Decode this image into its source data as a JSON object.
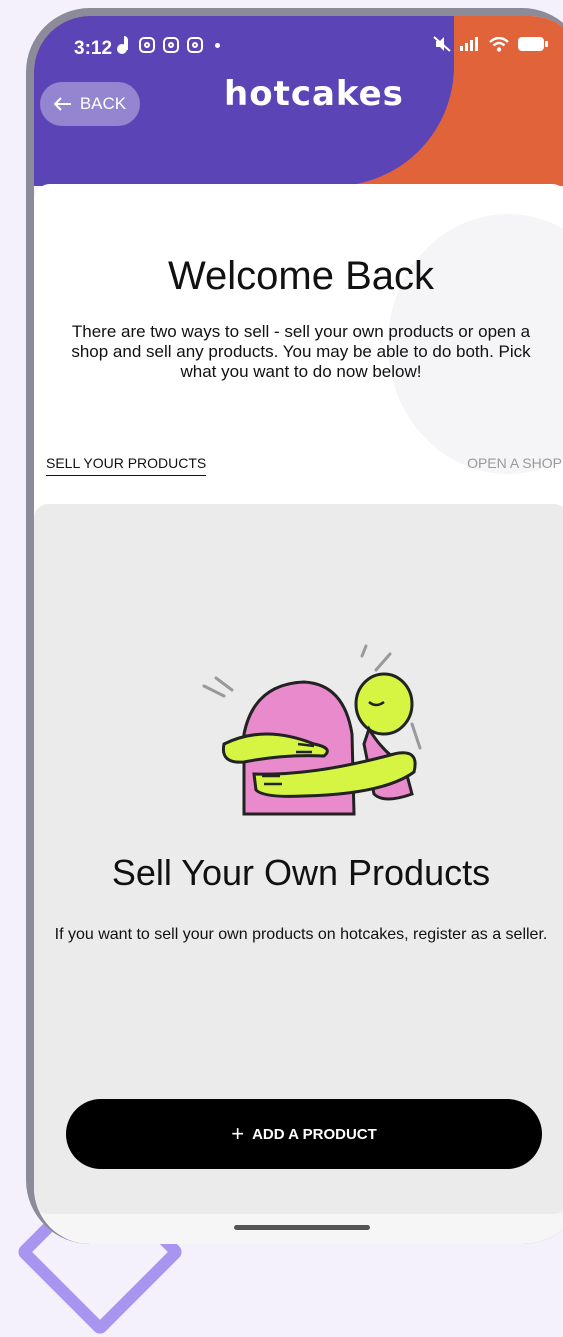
{
  "status_bar": {
    "time": "3:12"
  },
  "header": {
    "back_label": "BACK",
    "logo_text": "hotcakes"
  },
  "welcome": {
    "title": "Welcome Back",
    "description": "There are two ways to sell - sell your own products or open a shop and sell any products.  You may be able to do both. Pick what you want to do now below!"
  },
  "tabs": [
    {
      "label": "SELL YOUR PRODUCTS",
      "active": true
    },
    {
      "label": "OPEN A SHOP",
      "active": false
    }
  ],
  "panel": {
    "title": "Sell Your Own Products",
    "description": "If you want to sell your own products on hotcakes, register as a seller.",
    "button_label": "ADD A PRODUCT"
  },
  "colors": {
    "header_purple": "#5a44b6",
    "header_orange": "#e0633a",
    "accent_green": "#d6f542",
    "accent_pink": "#e88acb"
  }
}
